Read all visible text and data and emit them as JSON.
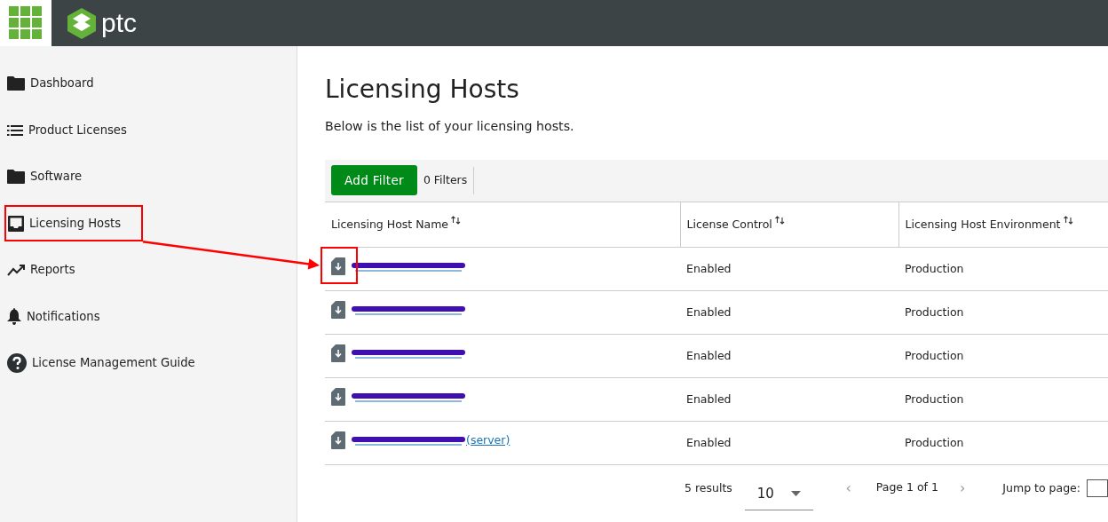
{
  "header": {
    "brand": "ptc"
  },
  "sidebar": {
    "items": [
      {
        "label": "Dashboard",
        "kind": "folder",
        "highlighted": false
      },
      {
        "label": "Product Licenses",
        "kind": "list",
        "highlighted": false
      },
      {
        "label": "Software",
        "kind": "folder",
        "highlighted": false
      },
      {
        "label": "Licensing Hosts",
        "kind": "inbox",
        "highlighted": true
      },
      {
        "label": "Reports",
        "kind": "chart",
        "highlighted": false
      },
      {
        "label": "Notifications",
        "kind": "bell",
        "highlighted": false
      },
      {
        "label": "License Management Guide",
        "kind": "help",
        "highlighted": false
      }
    ]
  },
  "page": {
    "title": "Licensing Hosts",
    "subtitle": "Below is the list of your licensing hosts."
  },
  "filter_bar": {
    "button": "Add Filter",
    "count": "0 Filters"
  },
  "table": {
    "columns": [
      "Licensing Host Name",
      "License Control",
      "Licensing Host Environment"
    ],
    "rows": [
      {
        "name": {
          "redacted": true
        },
        "license_control": "Enabled",
        "environment": "Production",
        "highlighted": true
      },
      {
        "name": {
          "redacted": true
        },
        "license_control": "Enabled",
        "environment": "Production",
        "highlighted": false
      },
      {
        "name": {
          "redacted": true
        },
        "license_control": "Enabled",
        "environment": "Production",
        "highlighted": false
      },
      {
        "name": {
          "redacted": true
        },
        "license_control": "Enabled",
        "environment": "Production",
        "highlighted": false
      },
      {
        "name": {
          "redacted": true,
          "suffix": "(server)"
        },
        "license_control": "Enabled",
        "environment": "Production",
        "highlighted": false
      }
    ]
  },
  "pagination": {
    "results": "5 results",
    "page_size": "10",
    "prev": "‹",
    "page_label": "Page 1 of 1",
    "next": "›",
    "jump_label": "Jump to page:"
  }
}
